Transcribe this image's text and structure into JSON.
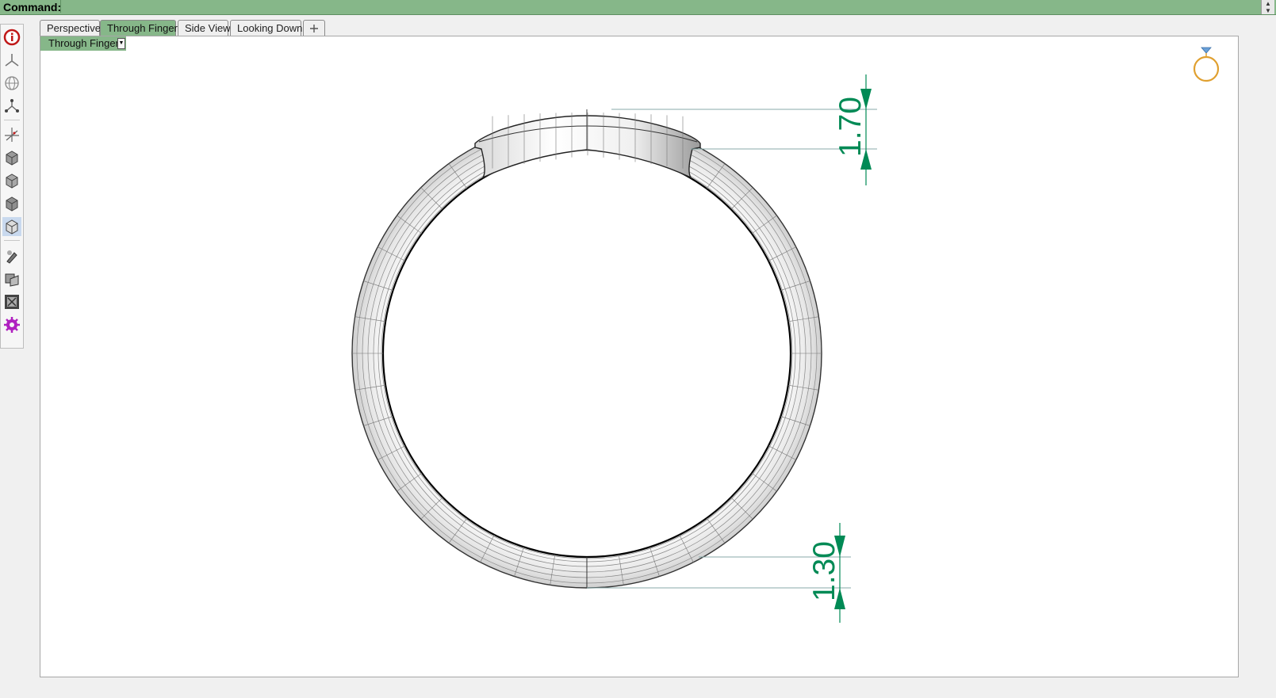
{
  "command": {
    "label": "Command:",
    "value": ""
  },
  "tabs": [
    {
      "label": "Perspective",
      "active": false
    },
    {
      "label": "Through Finger",
      "active": true
    },
    {
      "label": "Side View",
      "active": false
    },
    {
      "label": "Looking Down",
      "active": false
    }
  ],
  "add_tab_icon": "plus-icon",
  "viewport": {
    "title": "Through Finger",
    "dropdown_icon": "triangle-down-icon"
  },
  "dimensions": {
    "top_thickness": "1.70",
    "bottom_thickness": "1.30"
  },
  "toolbar_icons": [
    "info-icon",
    "gumball-icon",
    "globe-icon",
    "snap-icon",
    "axis-icon",
    "box-icon-1",
    "box-icon-2",
    "box-icon-3",
    "box-icon-4",
    "render-icon",
    "material-icon",
    "section-icon",
    "settings-icon"
  ],
  "colors": {
    "accent": "#86b789",
    "dimension": "#008a55",
    "ring_logo": "#e0a030"
  }
}
